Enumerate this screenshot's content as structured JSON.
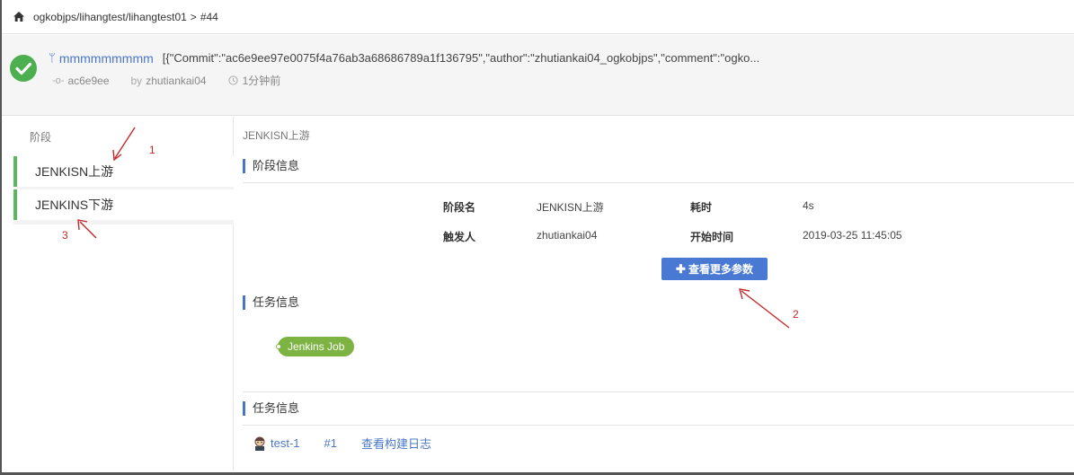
{
  "breadcrumb": {
    "path": "ogkobjps/lihangtest/lihangtest01",
    "separator": ">",
    "build": "#44"
  },
  "commit": {
    "branch": "mmmmmmmmm",
    "message": "[{\"Commit\":\"ac6e9ee97e0075f4a76ab3a68686789a1f136795\",\"author\":\"zhutiankai04_ogkobjps\",\"comment\":\"ogko...",
    "hash": "ac6e9ee",
    "by_label": "by",
    "author": "zhutiankai04",
    "time": "1分钟前",
    "status_color": "#4caf50"
  },
  "stages": {
    "title": "阶段",
    "items": [
      {
        "label": "JENKISN上游"
      },
      {
        "label": "JENKINS下游"
      }
    ],
    "accent_color": "#5cb85c"
  },
  "detail": {
    "crumb": "JENKISN上游",
    "stage_info": {
      "heading": "阶段信息",
      "fields": [
        {
          "label": "阶段名",
          "value": "JENKISN上游"
        },
        {
          "label": "耗时",
          "value": "4s"
        },
        {
          "label": "触发人",
          "value": "zhutiankai04"
        },
        {
          "label": "开始时间",
          "value": "2019-03-25 11:45:05"
        }
      ],
      "more_button": "查看更多参数"
    },
    "task_info": {
      "heading": "任务信息",
      "job_pill": "Jenkins Job"
    },
    "task_info2": {
      "heading": "任务信息",
      "job_name": "test-1",
      "build_no": "#1",
      "log_link": "查看构建日志"
    }
  },
  "annotations": [
    "1",
    "2",
    "3"
  ],
  "colors": {
    "link": "#4a77c4",
    "button": "#4a79d4",
    "pill": "#7cb342",
    "annotation": "#c62828"
  }
}
